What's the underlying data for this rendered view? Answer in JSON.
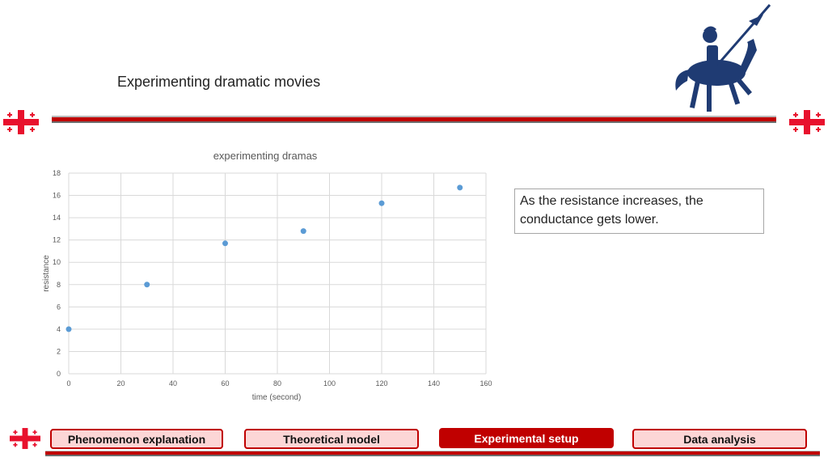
{
  "slide": {
    "title": "Experimenting dramatic movies",
    "note": "As the resistance increases, the conductance gets lower."
  },
  "colors": {
    "accent": "#c00000",
    "tab_fill": "#fcd6d6",
    "marker": "#5b9bd5",
    "knight": "#1f3b73"
  },
  "icons": {
    "flag": "georgian-flag-icon",
    "logo": "knight-on-horse-logo"
  },
  "nav": {
    "tabs": [
      {
        "label": "Phenomenon explanation",
        "active": false
      },
      {
        "label": "Theoretical model",
        "active": false
      },
      {
        "label": "Experimental setup",
        "active": true
      },
      {
        "label": "Data analysis",
        "active": false
      }
    ]
  },
  "chart_data": {
    "type": "scatter",
    "title": "experimenting dramas",
    "xlabel": "time (second)",
    "ylabel": "resistance",
    "xlim": [
      0,
      160
    ],
    "ylim": [
      0,
      18
    ],
    "xticks": [
      0,
      20,
      40,
      60,
      80,
      100,
      120,
      140,
      160
    ],
    "yticks": [
      0,
      2,
      4,
      6,
      8,
      10,
      12,
      14,
      16,
      18
    ],
    "grid": true,
    "series": [
      {
        "x": [
          0,
          30,
          60,
          90,
          120,
          150
        ],
        "y": [
          4,
          8,
          11.7,
          12.8,
          15.3,
          16.7
        ]
      }
    ]
  }
}
